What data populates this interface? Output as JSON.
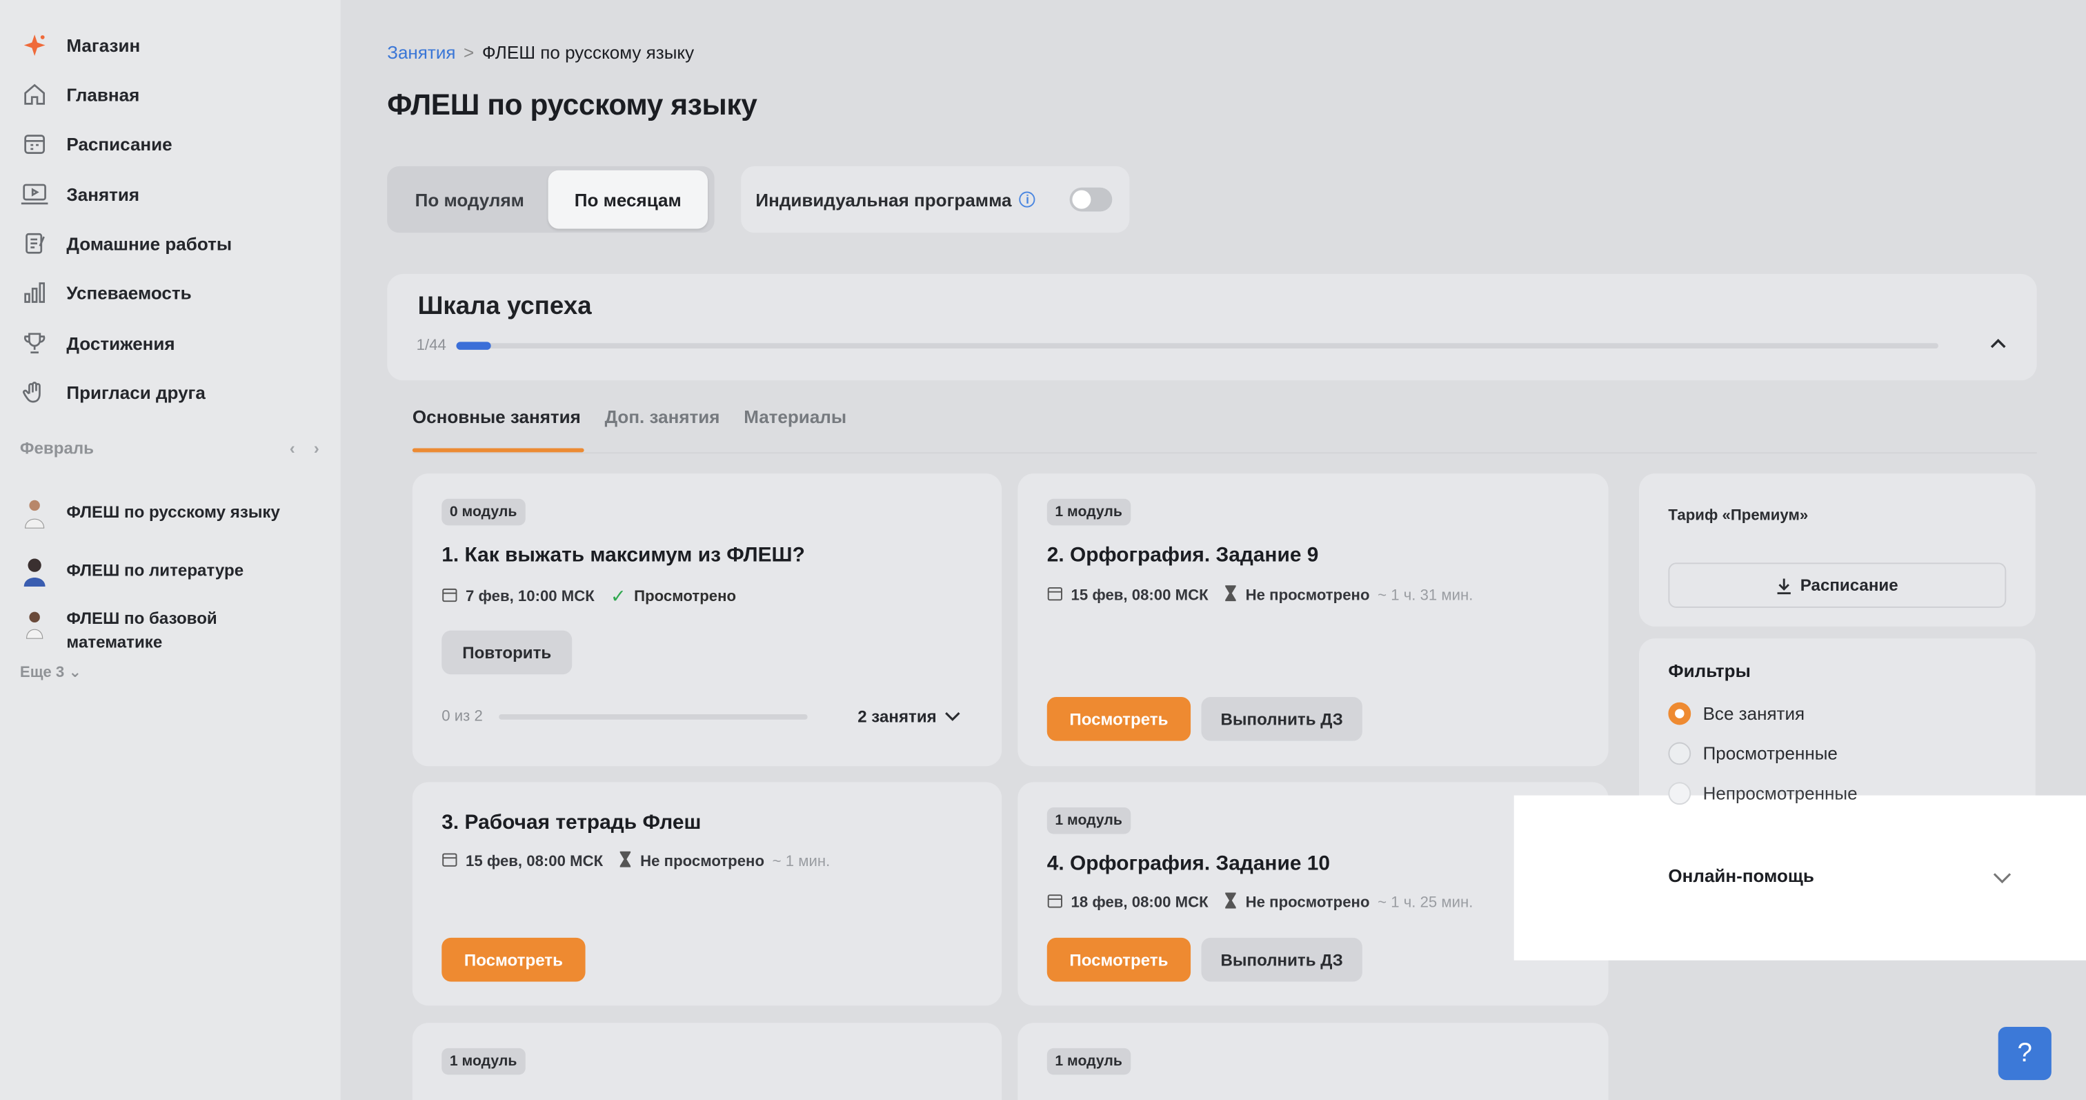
{
  "sidebar": {
    "nav": [
      {
        "label": "Магазин",
        "icon": "sparkle-icon"
      },
      {
        "label": "Главная",
        "icon": "home-icon"
      },
      {
        "label": "Расписание",
        "icon": "calendar-icon"
      },
      {
        "label": "Занятия",
        "icon": "play-monitor-icon"
      },
      {
        "label": "Домашние работы",
        "icon": "homework-icon"
      },
      {
        "label": "Успеваемость",
        "icon": "bar-chart-icon"
      },
      {
        "label": "Достижения",
        "icon": "trophy-icon"
      },
      {
        "label": "Пригласи друга",
        "icon": "hand-wave-icon"
      }
    ],
    "month": "Февраль",
    "courses": [
      {
        "label": "ФЛЕШ по русскому языку"
      },
      {
        "label": "ФЛЕШ по литературе"
      },
      {
        "label": "ФЛЕШ по базовой математике"
      }
    ],
    "more": "Еще 3"
  },
  "header": {
    "breadcrumb_link": "Занятия",
    "breadcrumb_sep": ">",
    "breadcrumb_current": "ФЛЕШ по русскому языку",
    "title": "ФЛЕШ по русскому языку"
  },
  "view_toggle": {
    "by_modules": "По модулям",
    "by_months": "По месяцам",
    "selected": "По месяцам"
  },
  "individual": {
    "label": "Индивидуальная программа",
    "enabled": false
  },
  "success_scale": {
    "title": "Шкала успеха",
    "count_text": "1/44",
    "progress": 0.0227
  },
  "tabs": [
    {
      "label": "Основные занятия",
      "active": true
    },
    {
      "label": "Доп. занятия",
      "active": false
    },
    {
      "label": "Материалы",
      "active": false
    }
  ],
  "lessons": [
    {
      "module": "0 модуль",
      "title": "1. Как выжать максимум из ФЛЕШ?",
      "date": "7 фев, 10:00 МСК",
      "status": "Просмотрено",
      "duration": "",
      "repeat_label": "Повторить",
      "progress_text": "0 из 2",
      "lessons_count": "2 занятия"
    },
    {
      "module": "1 модуль",
      "title": "2. Орфография. Задание 9",
      "date": "15 фев, 08:00 МСК",
      "status": "Не просмотрено",
      "duration": "~ 1 ч. 31 мин.",
      "watch_label": "Посмотреть",
      "hw_label": "Выполнить ДЗ"
    },
    {
      "module": "",
      "title": "3. Рабочая тетрадь Флеш",
      "date": "15 фев, 08:00 МСК",
      "status": "Не просмотрено",
      "duration": "~ 1 мин.",
      "watch_label": "Посмотреть"
    },
    {
      "module": "1 модуль",
      "title": "4. Орфография. Задание 10",
      "date": "18 фев, 08:00 МСК",
      "status": "Не просмотрено",
      "duration": "~ 1 ч. 25 мин.",
      "watch_label": "Посмотреть",
      "hw_label": "Выполнить ДЗ"
    },
    {
      "module": "1 модуль"
    },
    {
      "module": "1 модуль"
    }
  ],
  "tariff": {
    "label": "Тариф «Премиум»",
    "schedule_button": "Расписание"
  },
  "filters": {
    "title": "Фильтры",
    "options": [
      "Все занятия",
      "Просмотренные",
      "Непросмотренные"
    ],
    "selected": "Все занятия"
  },
  "help": {
    "label": "Онлайн-помощь",
    "fab": "?"
  },
  "colors": {
    "accent_orange": "#ee8a31",
    "link_blue": "#3a76d6",
    "progress_blue": "#3b6fd8"
  }
}
